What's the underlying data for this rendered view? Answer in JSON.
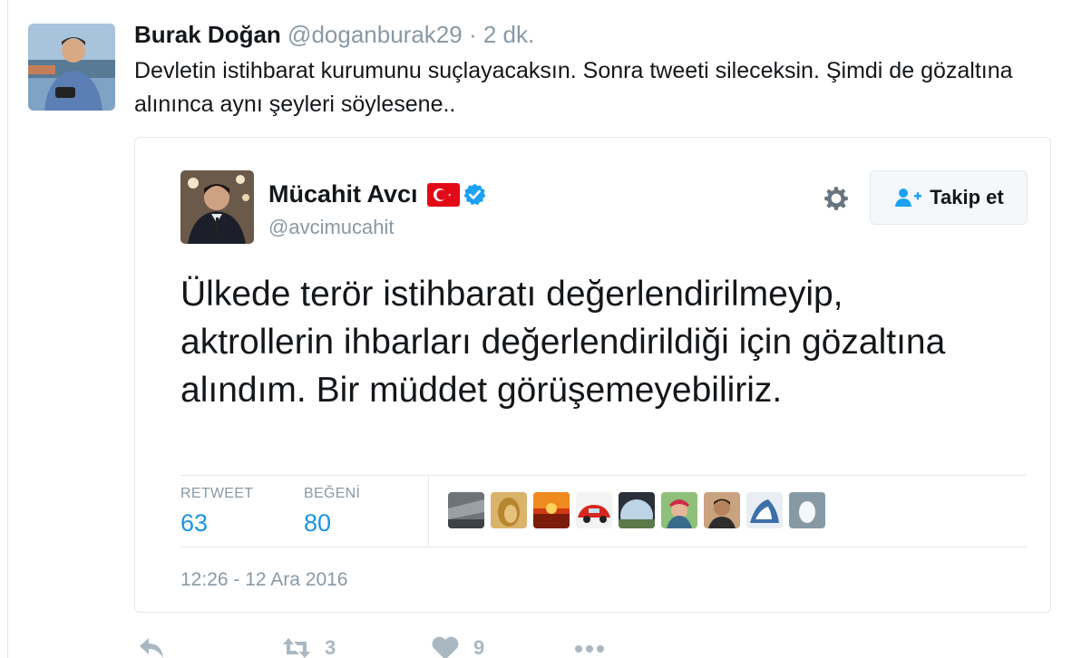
{
  "outer_tweet": {
    "name": "Burak Doğan",
    "handle": "@doganburak29",
    "separator": "·",
    "time": "2 dk.",
    "text": "Devletin istihbarat kurumunu suçlayacaksın. Sonra tweeti sileceksin. Şimdi de gözaltına alınınca aynı şeyleri söylesene.."
  },
  "quoted_tweet": {
    "name": "Mücahit Avcı",
    "handle": "@avcimucahit",
    "follow_label": "Takip et",
    "text": "Ülkede terör istihbaratı değerlendirilmeyip, aktrollerin ihbarları değerlendirildiği için gözaltına alındım. Bir müddet görüşemeyebiliriz.",
    "stats": {
      "retweet_label": "RETWEET",
      "retweet_count": "63",
      "like_label": "BEĞENİ",
      "like_count": "80"
    },
    "date": "12:26 - 12 Ara 2016",
    "flag_color": "#e30a17",
    "verified_color": "#1da1f2"
  },
  "actions": {
    "retweet_count": "3",
    "like_count": "9"
  },
  "icons": [
    "flag-icon",
    "verified-icon",
    "gear-icon",
    "follow-icon",
    "reply-icon",
    "retweet-icon",
    "heart-icon",
    "more-icon"
  ]
}
